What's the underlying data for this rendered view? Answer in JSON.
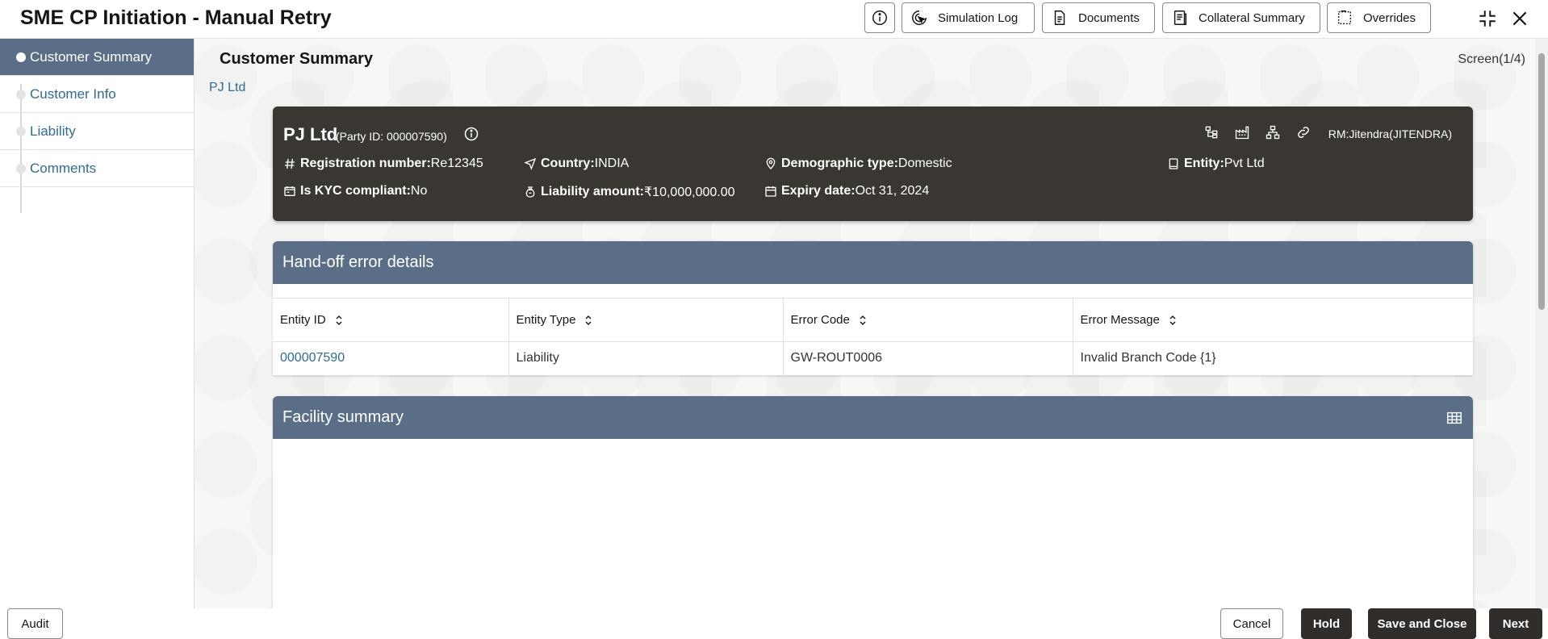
{
  "app": {
    "title": "SME CP Initiation - Manual Retry"
  },
  "header_buttons": {
    "simulation_log": "Simulation Log",
    "documents": "Documents",
    "collateral_summary": "Collateral Summary",
    "overrides": "Overrides"
  },
  "sidebar": {
    "items": [
      {
        "label": "Customer Summary",
        "active": true
      },
      {
        "label": "Customer Info",
        "active": false
      },
      {
        "label": "Liability",
        "active": false
      },
      {
        "label": "Comments",
        "active": false
      }
    ]
  },
  "page": {
    "title": "Customer Summary",
    "screen": "Screen(1/4)",
    "breadcrumb": "PJ Ltd"
  },
  "customer": {
    "name": "PJ Ltd",
    "party_id": "(Party ID: 000007590)",
    "rm": "RM:Jitendra(JITENDRA)",
    "fields": {
      "registration_label": "Registration number:",
      "registration_value": "Re12345",
      "country_label": "Country:",
      "country_value": "INDIA",
      "demographic_label": "Demographic type:",
      "demographic_value": "Domestic",
      "entity_label": "Entity:",
      "entity_value": "Pvt Ltd",
      "kyc_label": "Is KYC compliant:",
      "kyc_value": "No",
      "liability_label": "Liability amount:",
      "liability_value": "₹10,000,000.00",
      "expiry_label": "Expiry date:",
      "expiry_value": "Oct 31, 2024"
    }
  },
  "handoff": {
    "title": "Hand-off error details",
    "columns": [
      "Entity ID",
      "Entity Type",
      "Error Code",
      "Error Message"
    ],
    "rows": [
      [
        "000007590",
        "Liability",
        "GW-ROUT0006",
        "Invalid Branch Code {1}"
      ]
    ]
  },
  "facility": {
    "title": "Facility summary"
  },
  "footer": {
    "audit": "Audit",
    "cancel": "Cancel",
    "hold": "Hold",
    "save_close": "Save and Close",
    "next": "Next"
  },
  "colors": {
    "panel_header": "#5a6f87",
    "card_dark": "#3a3632",
    "link": "#2e6c93",
    "primary_button": "#312d2a"
  }
}
